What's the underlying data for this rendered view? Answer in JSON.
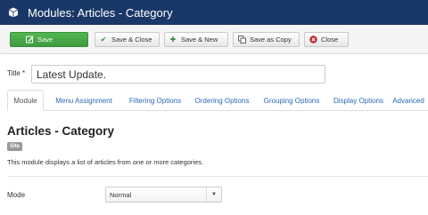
{
  "header": {
    "title": "Modules: Articles - Category",
    "icon": "cube-icon"
  },
  "toolbar": {
    "save": {
      "label": "Save",
      "icon": "edit-icon"
    },
    "save_close": {
      "label": "Save & Close",
      "icon": "check-icon"
    },
    "save_new": {
      "label": "Save & New",
      "icon": "plus-icon"
    },
    "save_copy": {
      "label": "Save as Copy",
      "icon": "copy-icon"
    },
    "close": {
      "label": "Close",
      "icon": "close-icon"
    }
  },
  "form": {
    "title_label": "Title *",
    "title_value": "Latest Update."
  },
  "tabs": [
    {
      "label": "Module",
      "active": true
    },
    {
      "label": "Menu Assignment"
    },
    {
      "label": "Filtering Options"
    },
    {
      "label": "Ordering Options"
    },
    {
      "label": "Grouping Options"
    },
    {
      "label": "Display Options"
    },
    {
      "label": "Advanced"
    }
  ],
  "module": {
    "title": "Articles - Category",
    "badge": "Site",
    "description": "This module displays a list of articles from one or more categories."
  },
  "mode": {
    "label": "Mode",
    "value": "Normal"
  },
  "colors": {
    "header": "#1a3867",
    "save": "#46a546",
    "link": "#2a69b8"
  }
}
